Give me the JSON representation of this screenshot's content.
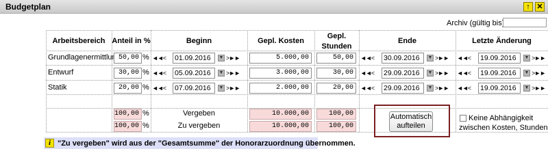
{
  "window": {
    "title": "Budgetplan"
  },
  "archiv": {
    "label": "Archiv (gültig bis):",
    "value": ""
  },
  "columns": {
    "arbeitsbereich": "Arbeitsbereich",
    "anteil": "Anteil in %",
    "beginn": "Beginn",
    "kosten": "Gepl. Kosten",
    "stunden_line1": "Gepl.",
    "stunden_line2": "Stunden",
    "ende": "Ende",
    "aenderung": "Letzte Änderung"
  },
  "rows": [
    {
      "name": "Grundlagenermittlung",
      "anteil": "50,00",
      "beginn": "01.09.2016",
      "kosten": "5.000,00",
      "stunden": "50,00",
      "ende": "30.09.2016",
      "aenderung": "19.09.2016"
    },
    {
      "name": "Entwurf",
      "anteil": "30,00",
      "beginn": "05.09.2016",
      "kosten": "3.000,00",
      "stunden": "30,00",
      "ende": "29.09.2016",
      "aenderung": "19.09.2016"
    },
    {
      "name": "Statik",
      "anteil": "20,00",
      "beginn": "07.09.2016",
      "kosten": "2.000,00",
      "stunden": "20,00",
      "ende": "29.09.2016",
      "aenderung": "19.09.2016"
    }
  ],
  "nav": {
    "left": "◄◄<",
    "right": ">►►"
  },
  "percent_sign": "%",
  "calendar_glyph": "▼",
  "summary": {
    "vergeben": {
      "label": "Vergeben",
      "anteil": "100,00",
      "kosten": "10.000,00",
      "stunden": "100,00"
    },
    "zu_vergeben": {
      "label": "Zu vergeben",
      "anteil": "100,00",
      "kosten": "10.000,00",
      "stunden": "100,00"
    }
  },
  "auto_button": {
    "line1": "Automatisch",
    "line2": "aufteilen"
  },
  "checkbox": {
    "label": "Keine Abhängigkeit zwischen Kosten, Stunden und Anteil in %",
    "checked": false
  },
  "info": {
    "icon": "info-icon",
    "text": "\"Zu vergeben\" wird aus der \"Gesamtsumme\" der Honorarzuordnung übernommen."
  },
  "colors": {
    "highlight_border": "#7a1f1f",
    "pink_field": "#f8dada",
    "info_bg": "#dcdff8",
    "icon_yellow": "#f3e200"
  }
}
